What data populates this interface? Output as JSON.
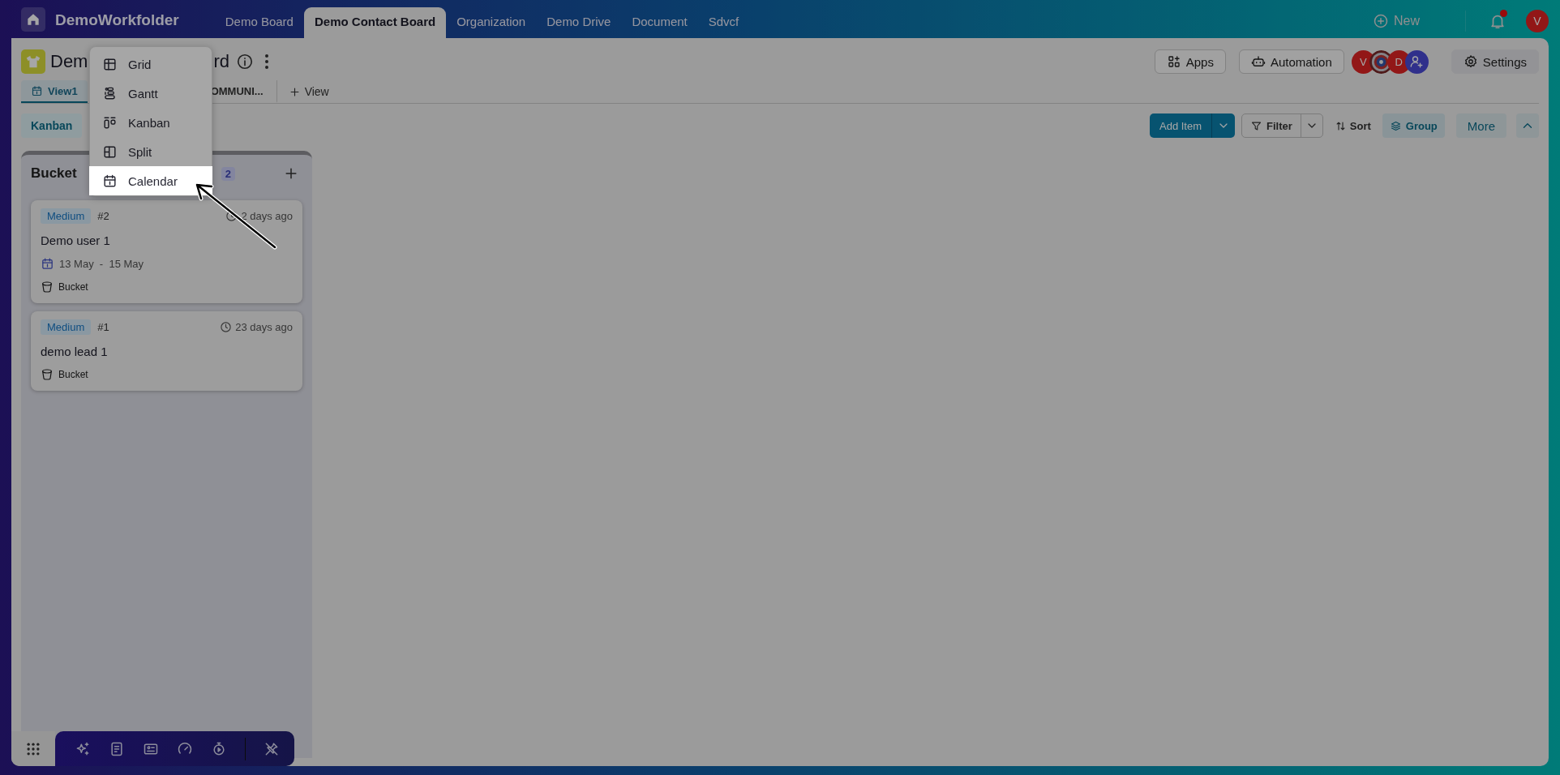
{
  "top_bar": {
    "workspace": "DemoWorkfolder",
    "tabs": [
      {
        "label": "Demo Board",
        "selected": false
      },
      {
        "label": "Demo Contact Board",
        "selected": true
      },
      {
        "label": "Organization",
        "selected": false
      },
      {
        "label": "Demo Drive",
        "selected": false
      },
      {
        "label": "Document",
        "selected": false
      },
      {
        "label": "Sdvcf",
        "selected": false
      }
    ],
    "new_button": "New",
    "notifications": {
      "unread": true
    },
    "user_avatar": {
      "initial": "V"
    }
  },
  "board": {
    "title_parts": [
      "Dem",
      "rd"
    ],
    "views": [
      {
        "label": "View1",
        "selected": true
      },
      {
        "label": "OMMUNI...",
        "selected": false
      }
    ],
    "add_view": "View",
    "apps": "Apps",
    "automation": "Automation",
    "members": [
      {
        "kind": "initial",
        "initial": "V"
      },
      {
        "kind": "picture"
      },
      {
        "kind": "initial",
        "initial": "D"
      },
      {
        "kind": "add"
      }
    ],
    "settings": "Settings"
  },
  "toolbar": {
    "layout": "Kanban",
    "add_item": "Add Item",
    "filter": "Filter",
    "sort": "Sort",
    "group": {
      "label": "Group",
      "on": true
    },
    "more": "More"
  },
  "column": {
    "title": "Bucket",
    "count": "2",
    "cards": [
      {
        "priority": "Medium",
        "number": "#2",
        "age": "2 days ago",
        "title": "Demo user 1",
        "date_range": "13 May  -  15 May",
        "bucket": "Bucket"
      },
      {
        "priority": "Medium",
        "number": "#1",
        "age": "23 days ago",
        "title": "demo lead 1",
        "bucket": "Bucket"
      }
    ]
  },
  "view_menu": [
    {
      "kind": "grid",
      "label": "Grid",
      "selected": false
    },
    {
      "kind": "gantt",
      "label": "Gantt",
      "selected": false
    },
    {
      "kind": "kanban",
      "label": "Kanban",
      "selected": false
    },
    {
      "kind": "split",
      "label": "Split",
      "selected": false
    },
    {
      "kind": "calendar",
      "label": "Calendar",
      "selected": true
    }
  ],
  "dock": [
    {
      "kind": "sparkle"
    },
    {
      "kind": "document"
    },
    {
      "kind": "id-card"
    },
    {
      "kind": "gauge"
    },
    {
      "kind": "stopwatch"
    },
    {
      "kind": "unpin"
    }
  ]
}
